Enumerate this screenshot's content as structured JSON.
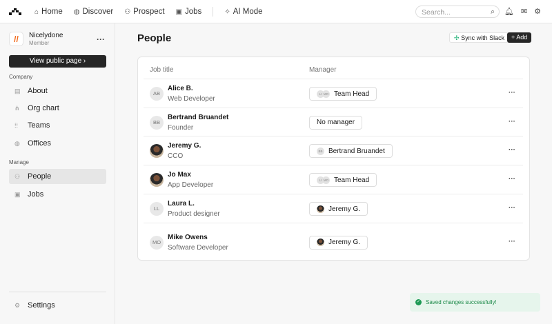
{
  "nav": {
    "items": [
      "Home",
      "Discover",
      "Prospect",
      "Jobs",
      "AI Mode"
    ],
    "search_placeholder": "Search..."
  },
  "org": {
    "name": "Nicelydone",
    "role": "Member",
    "view_public": "View public page"
  },
  "sidebar": {
    "company_label": "Company",
    "company": [
      "About",
      "Org chart",
      "Teams",
      "Offices"
    ],
    "manage_label": "Manage",
    "manage": [
      "People",
      "Jobs"
    ],
    "settings": "Settings"
  },
  "page": {
    "title": "People",
    "sync": "Sync with Slack",
    "add": "Add"
  },
  "table": {
    "headers": [
      "Job title",
      "Manager"
    ],
    "rows": [
      {
        "initials": "AB",
        "name": "Alice B.",
        "role": "Web Developer",
        "manager": "Team Head",
        "mgr_avatars": [
          "LI",
          "MO"
        ]
      },
      {
        "initials": "BB",
        "name": "Bertrand Bruandet",
        "role": "Founder",
        "manager": "No manager",
        "mgr_avatars": []
      },
      {
        "initials": "",
        "name": "Jeremy G.",
        "role": "CCO",
        "manager": "Bertrand Bruandet",
        "mgr_avatars": [
          "BB"
        ]
      },
      {
        "initials": "",
        "name": "Jo Max",
        "role": "App Developer",
        "manager": "Team Head",
        "mgr_avatars": [
          "LI",
          "MO"
        ]
      },
      {
        "initials": "LL",
        "name": "Laura L.",
        "role": "Product designer",
        "manager": "Jeremy G.",
        "mgr_avatars": [
          "photo"
        ]
      },
      {
        "initials": "MO",
        "name": "Mike Owens",
        "role": "Software Developer",
        "manager": "Jeremy G.",
        "mgr_avatars": [
          "photo"
        ]
      }
    ]
  },
  "toast": "Saved changes successfully!"
}
